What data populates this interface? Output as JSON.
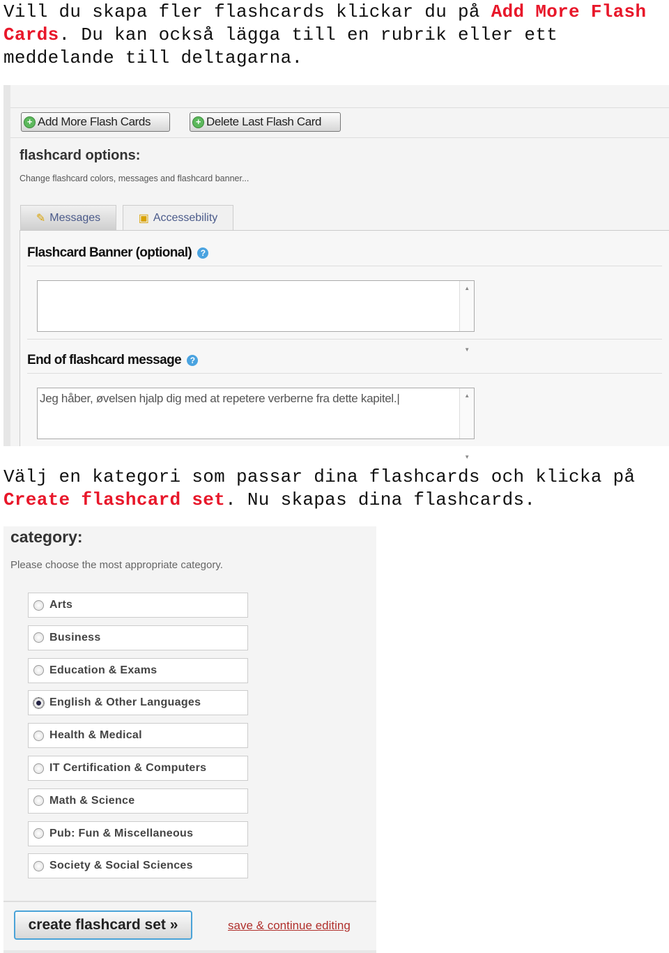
{
  "intro": {
    "text_before": "Vill du skapa fler flashcards klickar du på ",
    "highlight": "Add More Flash Cards",
    "text_after": ". Du kan också lägga till en rubrik eller ett meddelande till deltagarna."
  },
  "shot1": {
    "add_button": "Add More Flash Cards",
    "delete_button": "Delete Last Flash Card",
    "options_title": "flashcard options:",
    "options_desc": "Change flashcard colors, messages and flashcard banner...",
    "tabs": [
      {
        "label": "Messages",
        "active": true
      },
      {
        "label": "Accessebility",
        "active": false
      }
    ],
    "banner_label": "Flashcard Banner (optional)",
    "banner_value": "",
    "end_label": "End of flashcard message",
    "end_value": "Jeg håber, øvelsen hjalp dig med at repetere verberne fra dette kapitel."
  },
  "middle": {
    "text_before": "Välj en kategori som passar dina flashcards och klicka på ",
    "highlight": "Create flashcard set",
    "text_after": ". Nu skapas dina flashcards."
  },
  "shot2": {
    "title": "category:",
    "desc": "Please choose the most appropriate category.",
    "categories": [
      {
        "label": "Arts",
        "selected": false
      },
      {
        "label": "Business",
        "selected": false
      },
      {
        "label": "Education & Exams",
        "selected": false
      },
      {
        "label": "English & Other Languages",
        "selected": true
      },
      {
        "label": "Health & Medical",
        "selected": false
      },
      {
        "label": "IT Certification & Computers",
        "selected": false
      },
      {
        "label": "Math & Science",
        "selected": false
      },
      {
        "label": "Pub: Fun & Miscellaneous",
        "selected": false
      },
      {
        "label": "Society & Social Sciences",
        "selected": false
      }
    ],
    "create_button": "create flashcard set »",
    "save_link": "save & continue editing"
  },
  "colors": {
    "highlight": "#e8172a",
    "link": "#b0302c",
    "button_border": "#4aa3d8"
  }
}
